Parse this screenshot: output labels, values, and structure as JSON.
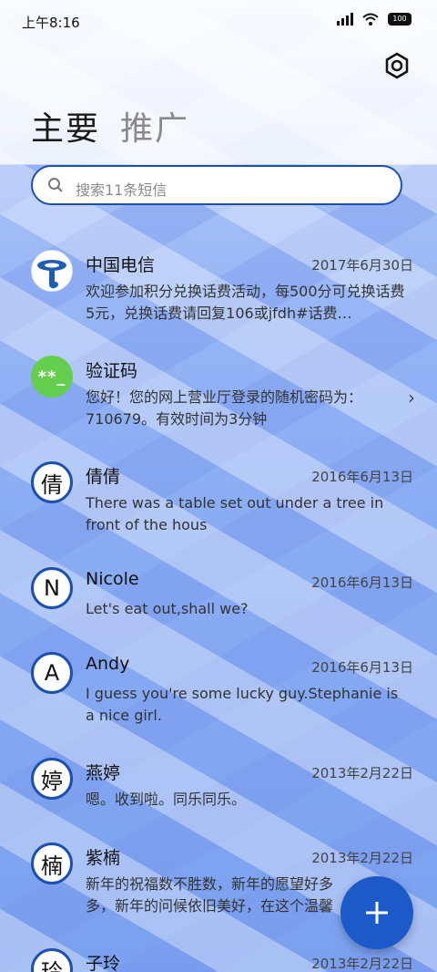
{
  "status_bar": {
    "time": "上午8:16",
    "battery": "100"
  },
  "tabs": [
    {
      "label": "主要",
      "active": true
    },
    {
      "label": "推广",
      "active": false
    }
  ],
  "search": {
    "placeholder": "搜索11条短信"
  },
  "conversations": [
    {
      "name": "中国电信",
      "date": "2017年6月30日",
      "preview": "欢迎参加积分兑换话费活动，每500分可兑换话费5元，兑换话费请回复106或jfdh#话费…",
      "avatar_type": "telecom-logo"
    },
    {
      "name": "验证码",
      "date": "",
      "preview": "您好！您的网上营业厅登录的随机密码为：710679。有效时间为3分钟",
      "avatar_type": "code",
      "avatar_text": "**_"
    },
    {
      "name": "倩倩",
      "date": "2016年6月13日",
      "preview": "There was a table set out under a tree in front of the hous",
      "avatar_text": "倩"
    },
    {
      "name": "Nicole",
      "date": "2016年6月13日",
      "preview": "Let's eat out,shall we?",
      "avatar_text": "N"
    },
    {
      "name": "Andy",
      "date": "2016年6月13日",
      "preview": "I guess you're some lucky guy.Stephanie is a nice girl.",
      "avatar_text": "A"
    },
    {
      "name": "燕婷",
      "date": "2013年2月22日",
      "preview": "嗯。收到啦。同乐同乐。",
      "avatar_text": "婷"
    },
    {
      "name": "紫楠",
      "date": "2013年2月22日",
      "preview": "新年的祝福数不胜数，新年的愿望好多多，新年的问候依旧美好，在这个温馨的",
      "avatar_text": "楠"
    },
    {
      "name": "子玲",
      "date": "2013年2月22日",
      "preview": "",
      "avatar_text": "玲"
    }
  ],
  "colors": {
    "accent": "#1b4fb0",
    "fab": "#1c59c9",
    "code_avatar": "#64cf4f"
  },
  "icons": {
    "settings": "gear-icon",
    "search": "search-icon",
    "compose": "plus-icon",
    "more": "chevron-right-icon"
  }
}
